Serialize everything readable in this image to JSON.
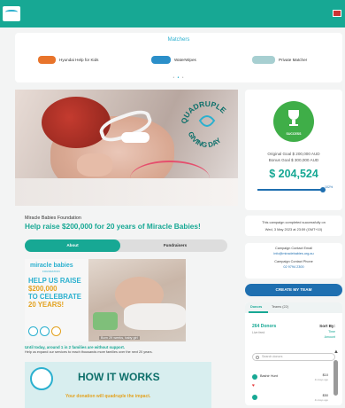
{
  "header": {
    "flag_icon": "uk-flag-icon"
  },
  "matchers": {
    "title": "Matchers",
    "sponsors": [
      {
        "name": "Hyundai Help for Kids",
        "color": "#e8742b"
      },
      {
        "name": "WaterWipes",
        "color": "#2b8fc9"
      },
      {
        "name": "Private Matcher",
        "color": "#a7cfd1"
      }
    ]
  },
  "hero": {
    "badge_top": "QUADRUPLE",
    "badge_bottom": "GIVING DAY"
  },
  "campaign": {
    "org": "Miracle Babies Foundation",
    "title": "Help raise $200,000 for 20 years of Miracle Babies!",
    "tabs": {
      "about": "About",
      "fundraisers": "Fundraisers"
    }
  },
  "promo": {
    "logo": "miracle babies",
    "logo_sub": "FOUNDATION",
    "line1": "HELP US RAISE",
    "line2": "$200,000",
    "line3": "TO CELEBRATE",
    "line4": "20 YEARS!",
    "caption": "Born 29 weeks, baby girl"
  },
  "story": {
    "stat": "Until today, around 1 in 2 families are without support.",
    "line": "Help us expand our services to reach thousands more families over the next 20 years."
  },
  "how": {
    "title": "HOW IT WORKS",
    "subtitle": "Your donation will quadruple the impact."
  },
  "goal": {
    "status": "SUCCESS",
    "original": "Original Goal $ 200,000 AUD",
    "bonus": "Bonus Goal $ 300,000 AUD",
    "raised": "$ 204,524",
    "progress_pct": 102,
    "pct_label": "102%"
  },
  "ended": {
    "line1": "This campaign completed successfully on",
    "line2": "Wed, 3 May 2023 at 23:59 (GMT+10)"
  },
  "contact": {
    "email_label": "Campaign Contact Email",
    "email": "info@miraclebabies.org.au",
    "phone_label": "Campaign Contact Phone",
    "phone": "02 9794 2300"
  },
  "create_button": "CREATE MY TEAM",
  "donors": {
    "tab_donors": "Donors",
    "tab_teams": "Teams (22)",
    "count": "264 Donors",
    "live": "Live feed",
    "sort_by": "Sort By:",
    "sort_time": "Time",
    "sort_amount": "Amount",
    "search_placeholder": "Search donors",
    "list": [
      {
        "name": "Bashir Hunt",
        "amount": "$10",
        "ago": "41 days ago"
      },
      {
        "name": "",
        "amount": "$50",
        "ago": "41 days ago"
      }
    ]
  }
}
